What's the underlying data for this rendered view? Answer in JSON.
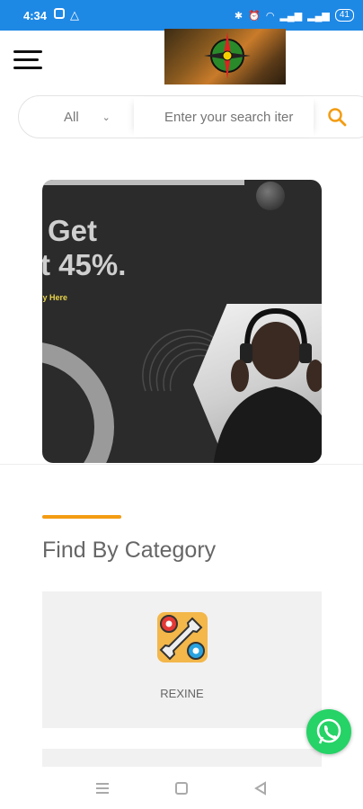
{
  "status_bar": {
    "time": "4:34",
    "battery": "41",
    "color": "#1e88e5"
  },
  "header": {
    "menu_icon": "hamburger-icon",
    "logo_icon": "compass-logo"
  },
  "search": {
    "category": "All",
    "placeholder": "Enter your search iter",
    "button_icon": "search-icon",
    "accent": "#f39c12"
  },
  "banner": {
    "line1": "Get",
    "line2": "t 45%.",
    "cta": "ly Here"
  },
  "section": {
    "title": "Find By Category"
  },
  "categories": [
    {
      "label": "REXINE",
      "icon": "wrench-gears-icon"
    }
  ],
  "whatsapp": {
    "icon": "whatsapp-icon",
    "color": "#25d366"
  },
  "nav": {
    "menu_icon": "recent-apps-icon",
    "home_icon": "home-square-icon",
    "back_icon": "back-triangle-icon"
  }
}
